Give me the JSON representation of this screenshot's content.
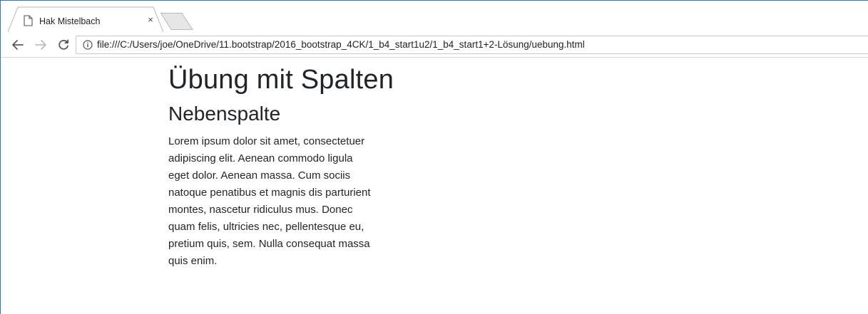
{
  "browser": {
    "tab": {
      "title": "Hak Mistelbach",
      "close_glyph": "×",
      "favicon": "page-icon"
    },
    "toolbar": {
      "back_icon": "arrow-left-icon",
      "forward_icon": "arrow-right-icon",
      "reload_icon": "reload-icon",
      "security_icon": "info-icon",
      "url": "file:///C:/Users/joe/OneDrive/11.bootstrap/2016_bootstrap_4CK/1_b4_start1u2/1_b4_start1+2-Lösung/uebung.html"
    }
  },
  "page": {
    "heading": "Übung mit Spalten",
    "subheading": "Nebenspalte",
    "paragraph": "Lorem ipsum dolor sit amet, consectetuer adipiscing elit. Aenean commodo ligula eget dolor. Aenean massa. Cum sociis natoque penatibus et magnis dis parturient montes, nascetur ridiculus mus. Donec quam felis, ultricies nec, pellentesque eu, pretium quis, sem. Nulla consequat massa quis enim."
  },
  "colors": {
    "text": "#212529",
    "window_border": "#3b6fb6",
    "tab_border": "#b9b9b9",
    "new_tab_fill": "#e6e6e6"
  }
}
